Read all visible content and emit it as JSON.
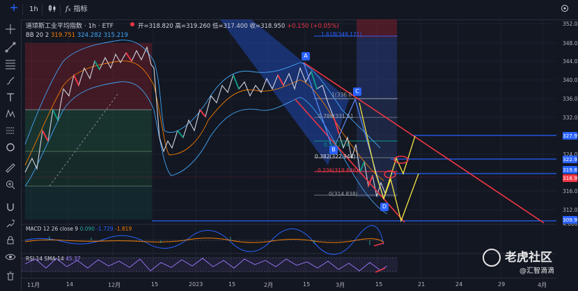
{
  "toolbar": {
    "interval": "1h",
    "indicators_label": "指标"
  },
  "legend": {
    "symbol": "道琼斯工业平均指数 · 1h · ETF",
    "open_label": "开=",
    "open": "318.820",
    "high_label": "高=",
    "high": "319.260",
    "low_label": "低=",
    "low": "317.400",
    "close_label": "收=",
    "close": "318.950",
    "change": "+0.150 (+0.05%)",
    "bb_label": "BB 20 2",
    "bb_basis": "319.751",
    "bb_upper": "324.282",
    "bb_lower": "315.219",
    "macd_label": "MACD 12 26 close 9",
    "macd_hist": "0.090",
    "macd_val": "-1.729",
    "macd_signal": "-1.819",
    "rsi_label": "RSI 14 SMA 14",
    "rsi_val": "45.37"
  },
  "price_axis": [
    "352.000",
    "348.000",
    "344.000",
    "340.000",
    "336.000",
    "332.000",
    "328.000",
    "324.000",
    "320.000",
    "316.000",
    "312.000",
    "4.000"
  ],
  "price_tags": {
    "t1": "327.957",
    "t2": "322.913",
    "t3": "319.836",
    "t4": "318.950",
    "t5": "309.956"
  },
  "fib": {
    "f1618": "1.618(349.171)",
    "f1": "1(336.0",
    "f786": "0.786(331.51",
    "f5": "0.5(325.4",
    "f382": "0.382(322.944)",
    "f236": "0.236(319.846)",
    "f0": "0(314.838)"
  },
  "waves": {
    "a": "A",
    "b": "B",
    "c": "C",
    "d": "D"
  },
  "time_axis": [
    "11月",
    "14",
    "12月",
    "15",
    "2023",
    "15",
    "2月",
    "15",
    "3月",
    "15",
    "21",
    "24",
    "29",
    "4月"
  ],
  "colors": {
    "bg": "#131722",
    "red": "#f23645",
    "blue": "#2962ff",
    "yellow": "#f5e642",
    "green": "#089981"
  },
  "watermark": {
    "brand": "老虎社区",
    "user": "@汇智滴滴"
  }
}
